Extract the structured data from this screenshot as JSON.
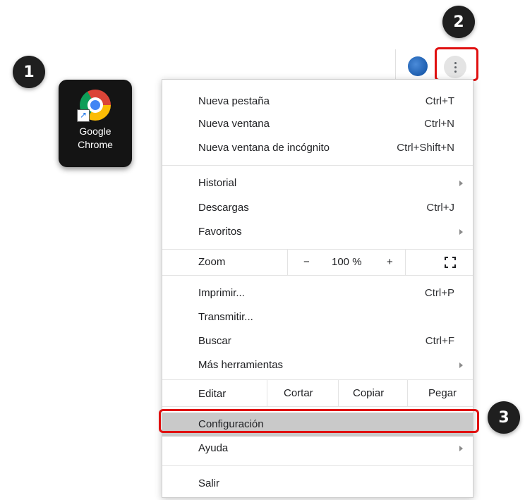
{
  "steps": {
    "one": "1",
    "two": "2",
    "three": "3"
  },
  "desktop_icon": {
    "label_line1": "Google",
    "label_line2": "Chrome",
    "icon": "chrome-logo-icon"
  },
  "toolbar": {
    "avatar_icon": "profile-avatar-icon",
    "menu_icon": "kebab-menu-icon"
  },
  "menu": {
    "group1": [
      {
        "label": "Nueva pestaña",
        "shortcut": "Ctrl+T"
      },
      {
        "label": "Nueva ventana",
        "shortcut": "Ctrl+N"
      },
      {
        "label": "Nueva ventana de incógnito",
        "shortcut": "Ctrl+Shift+N"
      }
    ],
    "group2": [
      {
        "label": "Historial",
        "shortcut": ""
      },
      {
        "label": "Descargas",
        "shortcut": "Ctrl+J"
      },
      {
        "label": "Favoritos",
        "shortcut": ""
      }
    ],
    "zoom": {
      "label": "Zoom",
      "minus": "−",
      "value": "100 %",
      "plus": "+",
      "fullscreen_icon": "fullscreen-icon"
    },
    "group3": [
      {
        "label": "Imprimir...",
        "shortcut": "Ctrl+P"
      },
      {
        "label": "Transmitir...",
        "shortcut": ""
      },
      {
        "label": "Buscar",
        "shortcut": "Ctrl+F"
      },
      {
        "label": "Más herramientas",
        "shortcut": ""
      }
    ],
    "edit": {
      "label": "Editar",
      "cut": "Cortar",
      "copy": "Copiar",
      "paste": "Pegar"
    },
    "group4": [
      {
        "label": "Configuración",
        "shortcut": ""
      },
      {
        "label": "Ayuda",
        "shortcut": ""
      }
    ],
    "exit": {
      "label": "Salir"
    }
  },
  "colors": {
    "highlight": "#e01010",
    "selected_row": "#c9c9c9",
    "step_badge": "#1f1f1f"
  }
}
